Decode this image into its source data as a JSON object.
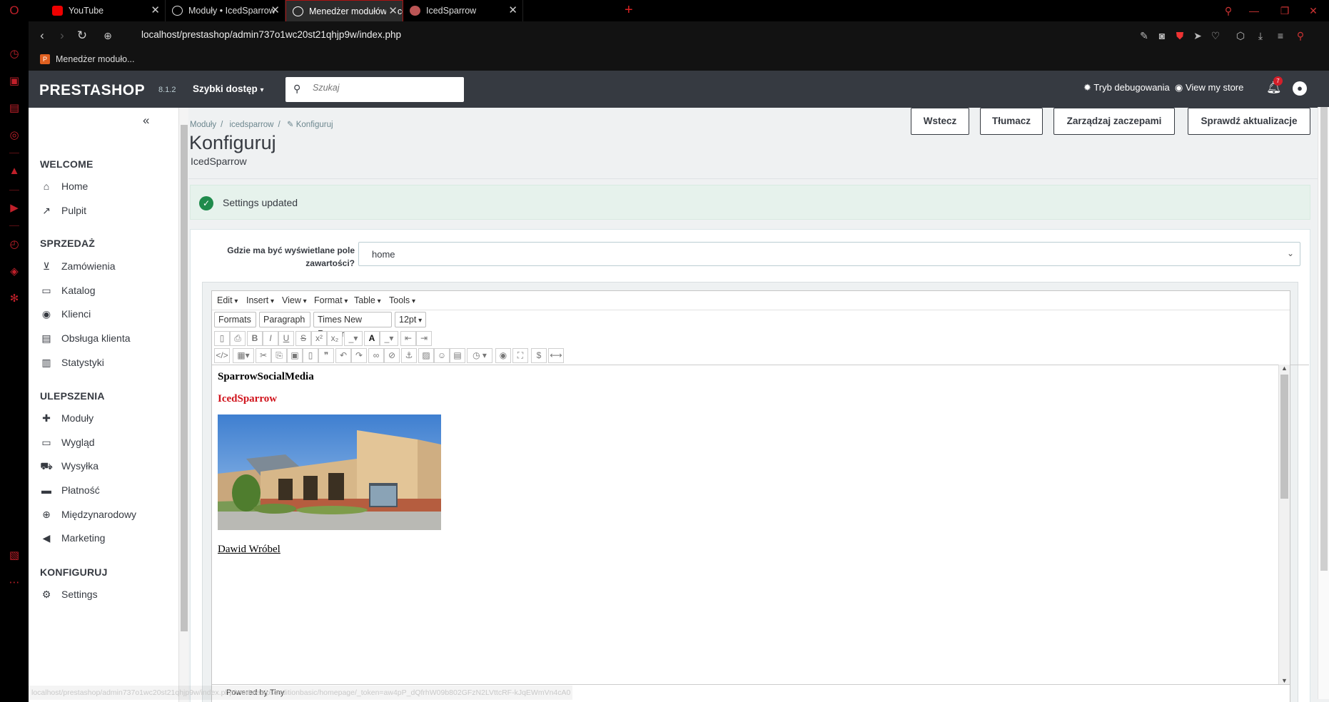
{
  "browser": {
    "tabs": [
      {
        "label": "YouTube",
        "icon": "youtube-icon",
        "active": false
      },
      {
        "label": "Moduły • IcedSparrow",
        "icon": "globe-icon",
        "active": false
      },
      {
        "label": "Menedżer modułów • IcedS",
        "icon": "globe-icon",
        "active": true
      },
      {
        "label": "IcedSparrow",
        "icon": "sparrow-icon",
        "active": false
      }
    ],
    "url": "localhost/prestashop/admin737o1wc20st21qhjp9w/index.php",
    "bookmark": "Menedżer moduło..."
  },
  "header": {
    "logo": "PRESTASHOP",
    "version": "8.1.2",
    "quick_access": "Szybki dostęp",
    "search_placeholder": "Szukaj",
    "debug": "Tryb debugowania",
    "view_store": "View my store",
    "notifications": "7"
  },
  "sidebar": {
    "sections": [
      {
        "title": "WELCOME",
        "items": [
          {
            "label": "Home",
            "icon": "home-icon"
          },
          {
            "label": "Pulpit",
            "icon": "trending-icon"
          }
        ]
      },
      {
        "title": "SPRZEDAŻ",
        "items": [
          {
            "label": "Zamówienia",
            "icon": "basket-icon"
          },
          {
            "label": "Katalog",
            "icon": "store-icon"
          },
          {
            "label": "Klienci",
            "icon": "user-circle-icon"
          },
          {
            "label": "Obsługa klienta",
            "icon": "chat-icon"
          },
          {
            "label": "Statystyki",
            "icon": "stats-icon"
          }
        ]
      },
      {
        "title": "ULEPSZENIA",
        "items": [
          {
            "label": "Moduły",
            "icon": "puzzle-icon"
          },
          {
            "label": "Wygląd",
            "icon": "monitor-icon"
          },
          {
            "label": "Wysyłka",
            "icon": "truck-icon"
          },
          {
            "label": "Płatność",
            "icon": "credit-card-icon"
          },
          {
            "label": "Międzynarodowy",
            "icon": "globe-icon"
          },
          {
            "label": "Marketing",
            "icon": "megaphone-icon"
          }
        ]
      },
      {
        "title": "KONFIGURUJ",
        "items": [
          {
            "label": "Settings",
            "icon": "gear-icon"
          }
        ]
      }
    ]
  },
  "main": {
    "breadcrumb": [
      "Moduły",
      "icedsparrow",
      "Konfiguruj"
    ],
    "title": "Konfiguruj",
    "subtitle": "IcedSparrow",
    "toolbar": [
      "Wstecz",
      "Tłumacz",
      "Zarządzaj zaczepami",
      "Sprawdź aktualizacje"
    ],
    "alert": "Settings updated",
    "field_label": "Gdzie ma być wyświetlane pole zawartości?",
    "field_value": "home"
  },
  "editor": {
    "menus": [
      "Edit",
      "Insert",
      "View",
      "Format",
      "Table",
      "Tools"
    ],
    "formats": "Formats",
    "block": "Paragraph",
    "font": "Times New Roman",
    "size": "12pt",
    "content": {
      "heading": "SparrowSocialMedia",
      "subheading": "IcedSparrow",
      "signature": "Dawid Wróbel"
    },
    "powered_by": "Powered by Tiny"
  },
  "status_url": "localhost/prestashop/admin737o1wc20st21qhjp9w/index.php/modules/psceditionbasic/homepage/_token=aw4pP_dQfrhW09b802GFzN2LVttcRF-kJqEWmVn4cA0"
}
